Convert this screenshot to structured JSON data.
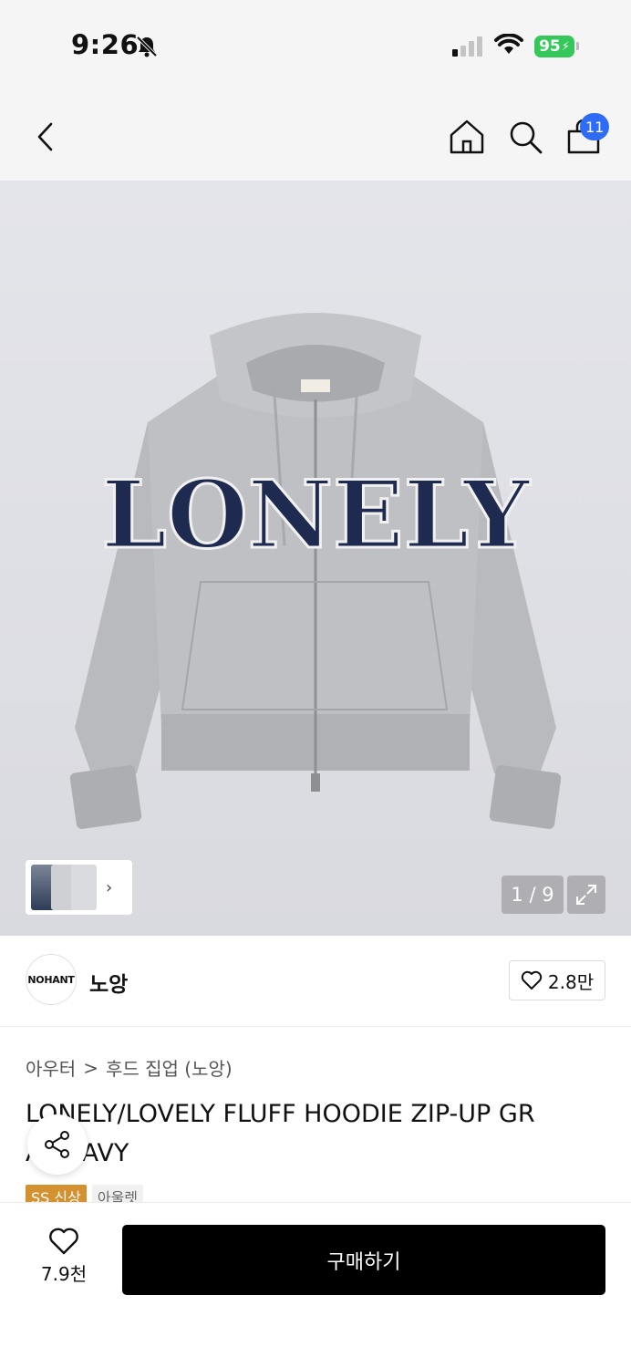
{
  "status_bar": {
    "time": "9:26",
    "battery": "95",
    "icons": [
      "bell-off-icon",
      "signal-icon",
      "wifi-icon",
      "battery-charging-icon"
    ]
  },
  "nav": {
    "cart_count": "11",
    "icons": [
      "back-arrow-icon",
      "home-icon",
      "search-icon",
      "shopping-bag-icon"
    ]
  },
  "gallery": {
    "counter": "1 / 9",
    "thumbnail_more": "›",
    "icons": [
      "expand-icon"
    ]
  },
  "brand": {
    "logo_text": "NOHANT",
    "name": "노앙",
    "likes": "2.8만"
  },
  "breadcrumb": {
    "category": "아우터",
    "separator": ">",
    "subcategory": "후드 집업 (노앙)"
  },
  "product": {
    "title_line1": "LONELY/LOVELY FLUFF HOODIE ZIP-UP GR",
    "title_line2": "AY NAVY",
    "print_text": "LONELY",
    "tags": [
      "SS 신상",
      "아울렛"
    ]
  },
  "bottom_bar": {
    "wish_count": "7.9천",
    "buy_label": "구매하기"
  },
  "colors": {
    "accent_blue": "#2f6cf6",
    "battery_green": "#34c759",
    "tag_orange": "#d4912f",
    "buy_button": "#000000",
    "hoodie_gray": "#b9babd",
    "print_navy": "#1e2a4f"
  }
}
